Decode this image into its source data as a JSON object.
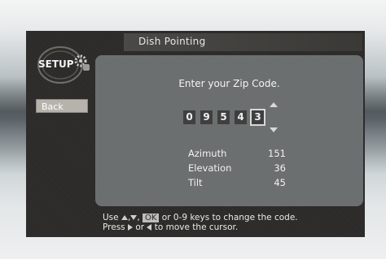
{
  "screen": {
    "title": "Dish Pointing",
    "setup_label": "SETUP",
    "back_label": "Back"
  },
  "zip": {
    "prompt": "Enter your Zip Code.",
    "digits": [
      "0",
      "9",
      "5",
      "4",
      "3"
    ],
    "active_index": 4
  },
  "info": [
    {
      "label": "Azimuth",
      "value": "151"
    },
    {
      "label": "Elevation",
      "value": "36"
    },
    {
      "label": "Tilt",
      "value": "45"
    }
  ],
  "help": {
    "line1_prefix": "Use",
    "line1_ok": "OK",
    "line1_suffix": "or 0-9 keys to change the code.",
    "line2_prefix": "Press",
    "line2_mid": "or",
    "line2_suffix": "to move the cursor."
  },
  "icons": [
    "setup-gear-icon",
    "arrow-up-icon",
    "arrow-down-icon",
    "arrow-left-icon",
    "arrow-right-icon"
  ]
}
